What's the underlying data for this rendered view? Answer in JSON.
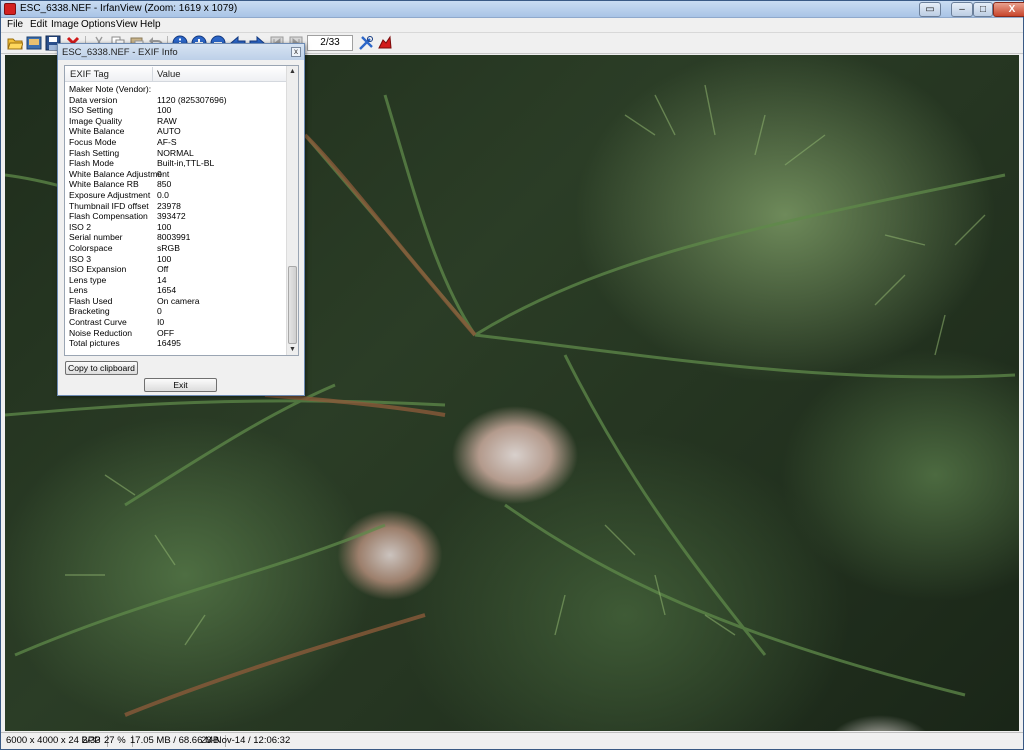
{
  "window": {
    "title": "ESC_6338.NEF - IrfanView (Zoom: 1619 x 1079)",
    "controls": {
      "minimize": "–",
      "maximize": "□",
      "close": "X"
    }
  },
  "menubar": [
    "File",
    "Edit",
    "Image",
    "Options",
    "View",
    "Help"
  ],
  "toolbar": {
    "page_field": "2/33"
  },
  "exif_dialog": {
    "title": "ESC_6338.NEF - EXIF Info",
    "columns": [
      "EXIF Tag",
      "Value"
    ],
    "rows": [
      [
        "Maker Note (Vendor):",
        ""
      ],
      [
        "Data version",
        "1120 (825307696)"
      ],
      [
        "ISO Setting",
        "100"
      ],
      [
        "Image Quality",
        "RAW"
      ],
      [
        "White Balance",
        "AUTO"
      ],
      [
        "Focus Mode",
        "AF-S"
      ],
      [
        "Flash Setting",
        "NORMAL"
      ],
      [
        "Flash Mode",
        "Built-in,TTL-BL"
      ],
      [
        "White Balance Adjustment",
        "0"
      ],
      [
        "White Balance RB",
        "850"
      ],
      [
        "Exposure Adjustment",
        "0.0"
      ],
      [
        "Thumbnail IFD offset",
        "23978"
      ],
      [
        "Flash Compensation",
        "393472"
      ],
      [
        "ISO 2",
        "100"
      ],
      [
        "Serial number",
        "8003991"
      ],
      [
        "Colorspace",
        "sRGB"
      ],
      [
        "ISO 3",
        "100"
      ],
      [
        "ISO Expansion",
        "Off"
      ],
      [
        "Lens type",
        "14"
      ],
      [
        "Lens",
        "1654"
      ],
      [
        "Flash Used",
        "On camera"
      ],
      [
        "Bracketing",
        "0"
      ],
      [
        "Contrast Curve",
        "I0"
      ],
      [
        "Noise Reduction",
        "OFF"
      ],
      [
        "Total pictures",
        "16495"
      ]
    ],
    "copy_button": "Copy to clipboard",
    "exit_button": "Exit"
  },
  "statusbar": {
    "dimensions": "6000 x 4000 x 24 BPP",
    "page": "2/33",
    "zoom": "27 %",
    "size": "17.05 MB / 68.66 MB",
    "datetime": "23-Nov-14 / 12:06:32"
  },
  "colors": {
    "titlebar": "#bdd0e8",
    "close_button": "#c8452c",
    "foliage": "#3f5b36"
  }
}
